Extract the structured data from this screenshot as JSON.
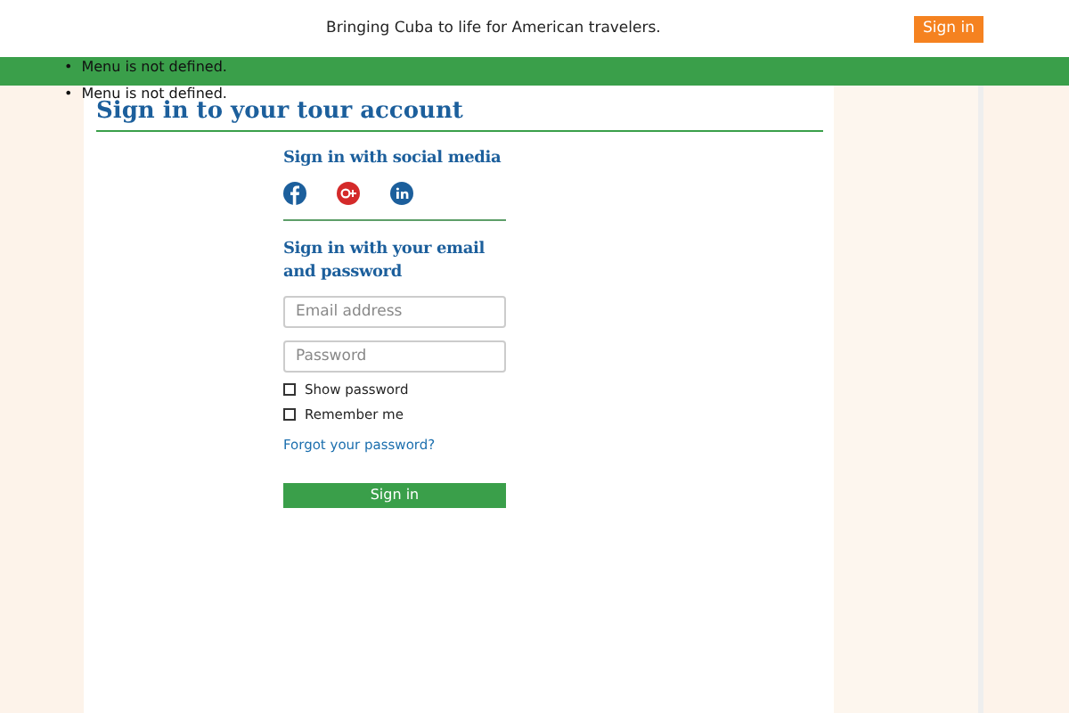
{
  "header": {
    "tagline": "Bringing Cuba to life for American travelers.",
    "sign_in_button": "Sign in"
  },
  "menu_notices": [
    {
      "bullet": "•",
      "text": "Menu is not defined."
    },
    {
      "bullet": "•",
      "text": "Menu is not defined."
    }
  ],
  "page_title": "Sign in to your tour account",
  "social": {
    "heading": "Sign in with social media",
    "networks": [
      {
        "kind": "facebook"
      },
      {
        "kind": "googleplus"
      },
      {
        "kind": "linkedin"
      }
    ]
  },
  "email_form": {
    "heading": "Sign in with your email and password",
    "email": {
      "placeholder": "Email address"
    },
    "password": {
      "placeholder": "Password"
    },
    "options": [
      {
        "label": "Show password",
        "checked": false
      },
      {
        "label": "Remember me",
        "checked": false
      }
    ],
    "forgot_link": "Forgot your password?",
    "submit": "Sign in"
  }
}
